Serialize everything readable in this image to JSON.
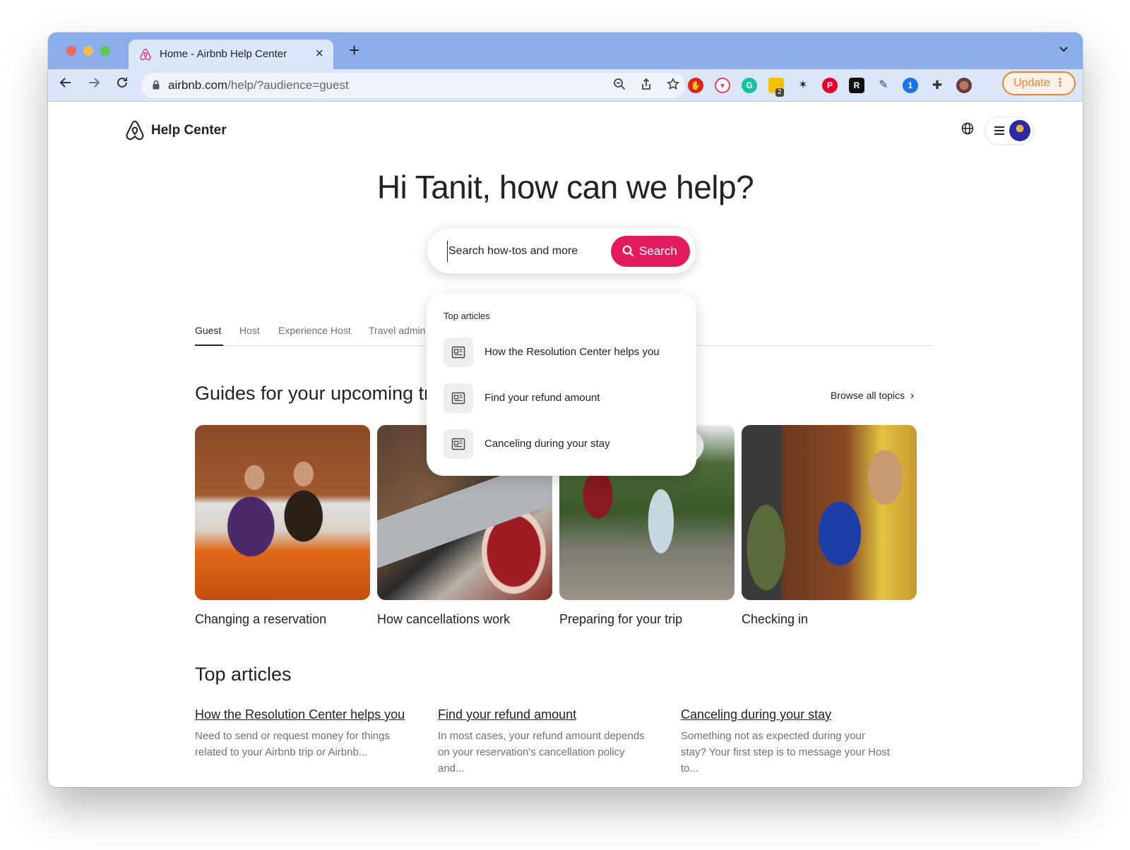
{
  "browser": {
    "tab_title": "Home - Airbnb Help Center",
    "tab_close": "×",
    "new_tab": "+",
    "url_host": "airbnb.com",
    "url_path": "/help/?audience=guest",
    "update_label": "Update",
    "update_menu": "⋮",
    "extension_badge": "2"
  },
  "header": {
    "brand": "Help Center"
  },
  "hero": {
    "greeting": "Hi Tanit, how can we help?"
  },
  "search": {
    "placeholder": "Search how-tos and more",
    "button_label": "Search"
  },
  "audience_tabs": [
    "Guest",
    "Host",
    "Experience Host",
    "Travel admin"
  ],
  "audience_active": "Guest",
  "dropdown": {
    "heading": "Top articles",
    "items": [
      "How the Resolution Center helps you",
      "Find your refund amount",
      "Canceling during your stay"
    ]
  },
  "guides": {
    "title": "Guides for your upcoming trip",
    "browse_label": "Browse all topics",
    "cards": [
      "Changing a reservation",
      "How cancellations work",
      "Preparing for your trip",
      "Checking in"
    ]
  },
  "top_articles": {
    "title": "Top articles",
    "items": [
      {
        "title": "How the Resolution Center helps you",
        "desc": "Need to send or request money for things related to your Airbnb trip or Airbnb..."
      },
      {
        "title": "Find your refund amount",
        "desc": "In most cases, your refund amount depends on your reservation's cancellation policy and..."
      },
      {
        "title": "Canceling during your stay",
        "desc": "Something not as expected during your stay? Your first step is to message your Host to..."
      }
    ]
  },
  "colors": {
    "brand": "#e31c5f",
    "chrome_tabbar": "#8aaeea",
    "chrome_toolbar": "#dbe6f9",
    "update_accent": "#e8833a"
  },
  "icons": [
    "airbnb-logo-icon",
    "back-arrow-icon",
    "forward-arrow-icon",
    "reload-icon",
    "lock-icon",
    "zoom-icon",
    "share-icon",
    "star-icon",
    "globe-icon",
    "menu-icon",
    "search-icon",
    "document-icon",
    "chevron-right-icon",
    "chevron-down-icon"
  ]
}
